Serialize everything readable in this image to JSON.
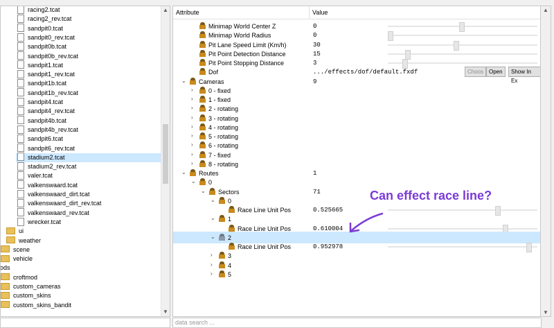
{
  "file_tree": {
    "items": [
      {
        "label": "racing2.tcat",
        "kind": "file"
      },
      {
        "label": "racing2_rev.tcat",
        "kind": "file"
      },
      {
        "label": "sandpit0.tcat",
        "kind": "file"
      },
      {
        "label": "sandpit0_rev.tcat",
        "kind": "file"
      },
      {
        "label": "sandpit0b.tcat",
        "kind": "file"
      },
      {
        "label": "sandpit0b_rev.tcat",
        "kind": "file"
      },
      {
        "label": "sandpit1.tcat",
        "kind": "file"
      },
      {
        "label": "sandpit1_rev.tcat",
        "kind": "file"
      },
      {
        "label": "sandpit1b.tcat",
        "kind": "file"
      },
      {
        "label": "sandpit1b_rev.tcat",
        "kind": "file"
      },
      {
        "label": "sandpit4.tcat",
        "kind": "file"
      },
      {
        "label": "sandpit4_rev.tcat",
        "kind": "file"
      },
      {
        "label": "sandpit4b.tcat",
        "kind": "file"
      },
      {
        "label": "sandpit4b_rev.tcat",
        "kind": "file"
      },
      {
        "label": "sandpit6.tcat",
        "kind": "file"
      },
      {
        "label": "sandpit6_rev.tcat",
        "kind": "file"
      },
      {
        "label": "stadium2.tcat",
        "kind": "file",
        "selected": true
      },
      {
        "label": "stadium2_rev.tcat",
        "kind": "file"
      },
      {
        "label": "valer.tcat",
        "kind": "file"
      },
      {
        "label": "valkenswaard.tcat",
        "kind": "file"
      },
      {
        "label": "valkenswaard_dirt.tcat",
        "kind": "file"
      },
      {
        "label": "valkenswaard_dirt_rev.tcat",
        "kind": "file"
      },
      {
        "label": "valkenswaard_rev.tcat",
        "kind": "file"
      },
      {
        "label": "wrecker.tcat",
        "kind": "file"
      },
      {
        "label": "ui",
        "kind": "folder"
      },
      {
        "label": "weather",
        "kind": "folder"
      },
      {
        "label": "scene",
        "kind": "folder"
      },
      {
        "label": "vehicle",
        "kind": "folder"
      },
      {
        "label": "nods",
        "kind": "text"
      },
      {
        "label": "croftmod",
        "kind": "folder"
      },
      {
        "label": "custom_cameras",
        "kind": "folder"
      },
      {
        "label": "custom_skins",
        "kind": "folder"
      },
      {
        "label": "custom_skins_bandit",
        "kind": "folder"
      }
    ]
  },
  "grid": {
    "header_attribute": "Attribute",
    "header_value": "Value",
    "search_placeholder": "data search ...",
    "rows": [
      {
        "label": "Minimap World Center Z",
        "value": "0",
        "indent": 2,
        "slider": 0.49
      },
      {
        "label": "Minimap World Radius",
        "value": "0",
        "indent": 2,
        "slider": 0.0
      },
      {
        "label": "Pit Lane Speed Limit (Km/h)",
        "value": "30",
        "indent": 2,
        "slider": 0.45
      },
      {
        "label": "Pit Point Detection Distance",
        "value": "15",
        "indent": 2,
        "slider": 0.12
      },
      {
        "label": "Pit Point Stopping Distance",
        "value": "3",
        "indent": 2,
        "slider": 0.1
      },
      {
        "label": "Dof",
        "value": ".../effects/dof/default.fxdf",
        "indent": 2,
        "buttons": [
          "Choos",
          "Open",
          "Show In Ex"
        ]
      },
      {
        "label": "Cameras",
        "value": "9",
        "indent": 1,
        "toggle": "expanded"
      },
      {
        "label": "0 - fixed",
        "indent": 2,
        "toggle": "collapsed"
      },
      {
        "label": "1 - fixed",
        "indent": 2,
        "toggle": "collapsed"
      },
      {
        "label": "2 - rotating",
        "indent": 2,
        "toggle": "collapsed"
      },
      {
        "label": "3 - rotating",
        "indent": 2,
        "toggle": "collapsed"
      },
      {
        "label": "4 - rotating",
        "indent": 2,
        "toggle": "collapsed"
      },
      {
        "label": "5 - rotating",
        "indent": 2,
        "toggle": "collapsed"
      },
      {
        "label": "6 - rotating",
        "indent": 2,
        "toggle": "collapsed"
      },
      {
        "label": "7 - fixed",
        "indent": 2,
        "toggle": "collapsed"
      },
      {
        "label": "8 - rotating",
        "indent": 2,
        "toggle": "collapsed"
      },
      {
        "label": "Routes",
        "value": "1",
        "indent": 1,
        "toggle": "expanded"
      },
      {
        "label": "0",
        "indent": 2,
        "toggle": "expanded"
      },
      {
        "label": "Sectors",
        "value": "71",
        "indent": 3,
        "toggle": "expanded"
      },
      {
        "label": "0",
        "indent": 4,
        "toggle": "expanded"
      },
      {
        "label": "Race Line Unit Pos",
        "value": "0.525665",
        "indent": 5,
        "slider": 0.74
      },
      {
        "label": "1",
        "indent": 4,
        "toggle": "expanded"
      },
      {
        "label": "Race Line Unit Pos",
        "value": "0.610004",
        "indent": 5,
        "slider": 0.79
      },
      {
        "label": "2",
        "indent": 4,
        "toggle": "expanded",
        "selected": true,
        "grey": true
      },
      {
        "label": "Race Line Unit Pos",
        "value": "0.952978",
        "indent": 5,
        "slider": 0.95
      },
      {
        "label": "3",
        "indent": 4,
        "toggle": "collapsed"
      },
      {
        "label": "4",
        "indent": 4,
        "toggle": "collapsed"
      },
      {
        "label": "5",
        "indent": 4,
        "toggle": "collapsed"
      }
    ]
  },
  "annotation": {
    "text": "Can effect race line?",
    "color": "#7b3bd6"
  },
  "icons": {
    "expanded": "chevron-down-icon",
    "collapsed": "chevron-right-icon"
  }
}
